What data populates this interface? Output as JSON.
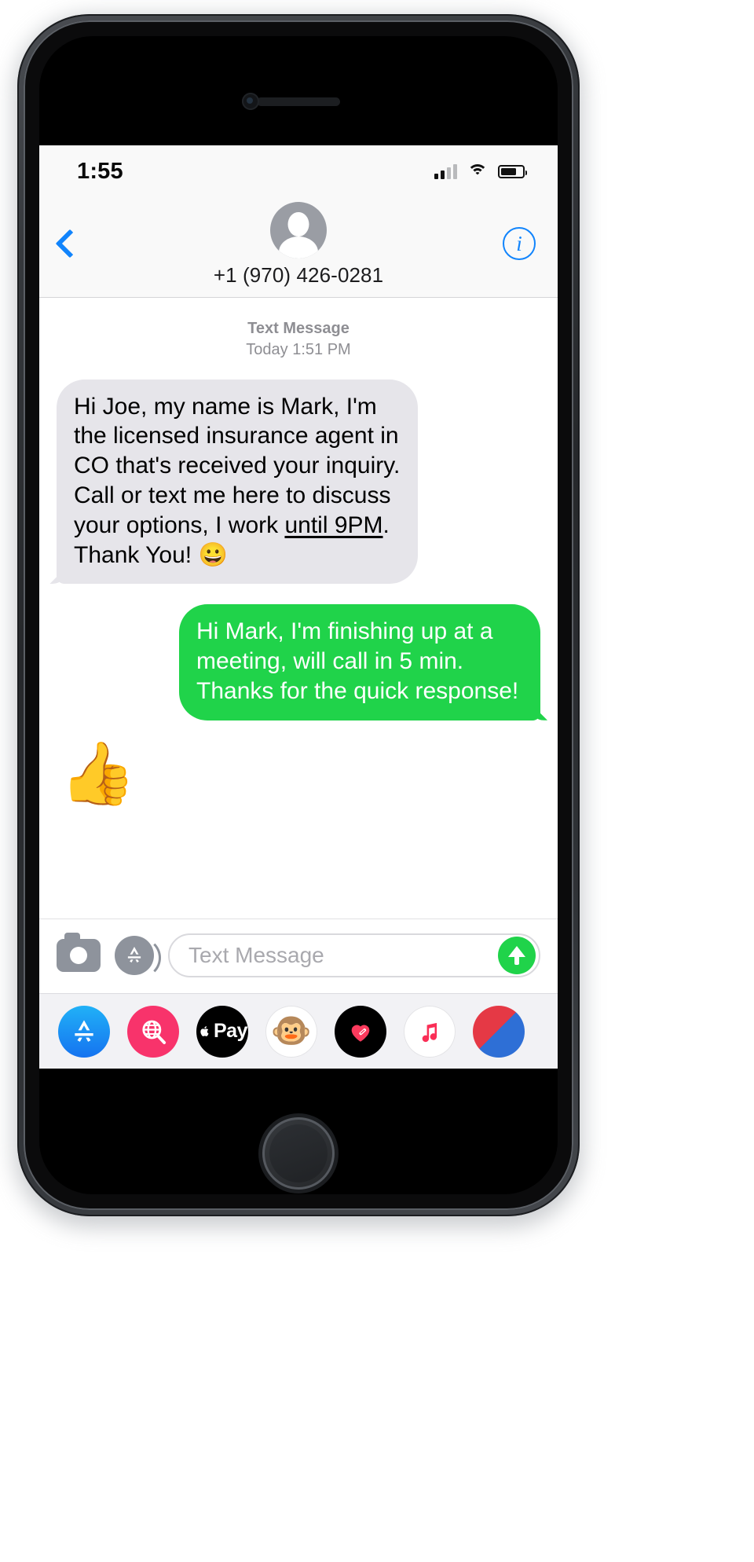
{
  "statusbar": {
    "time": "1:55",
    "signal_icon": "cellular-signal-icon",
    "wifi_icon": "wifi-icon",
    "battery_icon": "battery-icon"
  },
  "navbar": {
    "back_label": "",
    "back_icon": "back-chevron-icon",
    "info_label": "i",
    "contact_name": "+1 (970) 426-0281",
    "avatar_icon": "contact-avatar-placeholder"
  },
  "conversation": {
    "daystamp": {
      "kind": "Text Message",
      "when": "Today 1:51 PM"
    },
    "messages": [
      {
        "direction": "in",
        "text_before_link": "Hi Joe, my name is Mark, I'm the licensed insurance agent in CO that's received your inquiry. Call or text me here to discuss your options, I work ",
        "link_text": "until 9PM",
        "text_after_link": ". Thank You! ",
        "emoji": "😀"
      },
      {
        "direction": "out",
        "text": "Hi Mark, I'm finishing up at a meeting, will call in 5 min. Thanks for the quick response!"
      },
      {
        "direction": "in",
        "big_emoji": "👍"
      }
    ]
  },
  "inputbar": {
    "camera_icon": "camera-icon",
    "appstore_icon": "imessage-apps-icon",
    "placeholder": "Text Message",
    "value": "",
    "send_icon": "send-arrow-icon"
  },
  "appdrawer": {
    "items": [
      {
        "name": "app-store",
        "label": ""
      },
      {
        "name": "images-gif",
        "label": ""
      },
      {
        "name": "apple-pay",
        "label": "Pay"
      },
      {
        "name": "memoji",
        "label": "🐵"
      },
      {
        "name": "digital-touch",
        "label": ""
      },
      {
        "name": "apple-music",
        "label": ""
      },
      {
        "name": "more-apps",
        "label": ""
      }
    ]
  },
  "colors": {
    "accent_blue": "#1184fc",
    "bubble_green": "#20d34a",
    "bubble_gray": "#e6e5ea",
    "text_secondary": "#8e8e93"
  }
}
